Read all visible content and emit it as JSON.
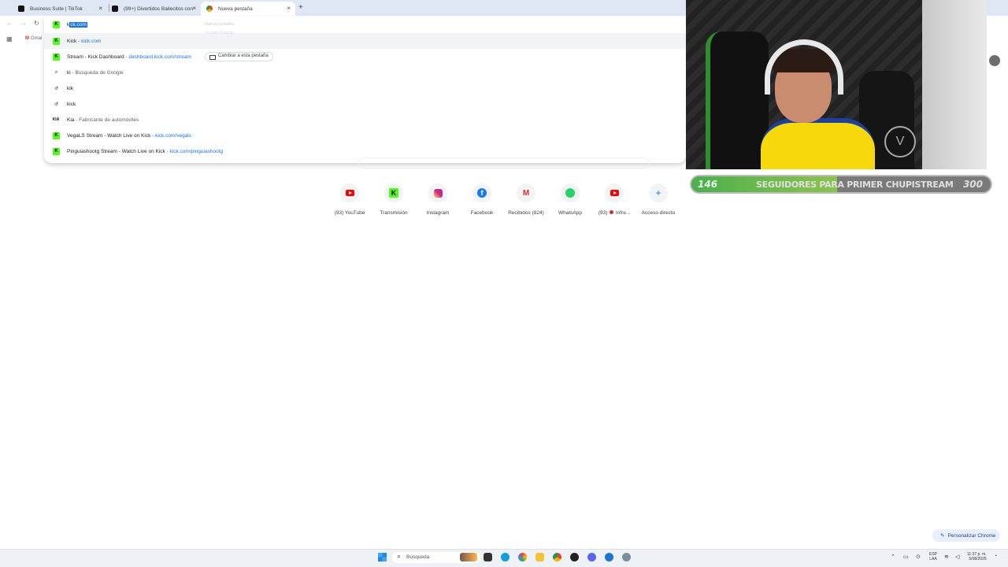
{
  "tabs": [
    {
      "title": "Business Suite | TikTok",
      "close": "×"
    },
    {
      "title": "(99+) Divertidos Bailecitos con",
      "close": "×"
    },
    {
      "title": "Nueva pestaña",
      "close": "×"
    }
  ],
  "newtab_symbol": "+",
  "bookmarks": {
    "gmail": "Gmai"
  },
  "omnibox": {
    "input_selected": "ck.com",
    "input_prefix": "ki",
    "ghost_title": "Nueva pestaña",
    "ghost_sub": "chrome://newtab",
    "suggestions": [
      {
        "label": "Kick",
        "sep": " - ",
        "url": "kick.com"
      },
      {
        "label": "Stream - Kick Dashboard",
        "sep": " - ",
        "url": "dashboard.kick.com/stream",
        "action": "Cambiar a esta pestaña"
      },
      {
        "label": "ki",
        "sep": " - ",
        "desc": "Búsqueda de Google"
      },
      {
        "label": "kik"
      },
      {
        "label": "kick"
      },
      {
        "label": "Kia",
        "sep": " - ",
        "desc": "Fabricante de automóviles"
      },
      {
        "label": "VegaLS Stream - Watch Live on Kick",
        "sep": " - ",
        "url": "kick.com/vegals"
      },
      {
        "label": "Pinguiashootg Stream - Watch Live on Kick",
        "sep": " - ",
        "url": "kick.com/pinguiashootg"
      }
    ]
  },
  "shortcuts": [
    {
      "label": "(93) YouTube",
      "icon": "youtube-icon"
    },
    {
      "label": "Transmisión",
      "icon": "kick-icon",
      "glyph": "K"
    },
    {
      "label": "Instagram",
      "icon": "instagram-icon"
    },
    {
      "label": "Facebook",
      "icon": "facebook-icon",
      "glyph": "f"
    },
    {
      "label": "Recibidos (824)",
      "icon": "gmail-icon",
      "glyph": "M"
    },
    {
      "label": "WhatsApp",
      "icon": "whatsapp-icon"
    },
    {
      "label_prefix": "(93)",
      "label_suffix": "Infre...",
      "icon": "youtube-icon"
    },
    {
      "label": "Acceso directo",
      "icon": "plus-icon",
      "glyph": "+"
    }
  ],
  "goal": {
    "current": "146",
    "title": "SEGUIDORES PARA PRIMER CHUPISTREAM",
    "target": "300",
    "progress": 0.487
  },
  "webcam": {
    "logo_text": "V"
  },
  "customize": {
    "label": "Personalizar Chrome"
  },
  "taskbar": {
    "search_placeholder": "Búsqueda",
    "lang_line1": "ESP",
    "lang_line2": "LAA",
    "time": "11:37 p. m.",
    "date": "5/08/2025"
  },
  "colors": {
    "kick_green": "#53fc18",
    "accent_blue": "#1a73e8"
  }
}
